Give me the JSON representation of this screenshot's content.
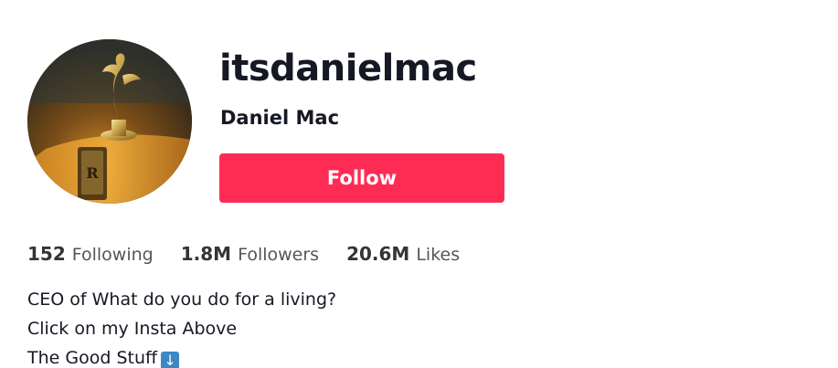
{
  "profile": {
    "username": "itsdanielmac",
    "display_name": "Daniel Mac",
    "follow_label": "Follow",
    "avatar_icon": "rolls-royce-hood-ornament"
  },
  "stats": [
    {
      "value": "152",
      "label": "Following"
    },
    {
      "value": "1.8M",
      "label": "Followers"
    },
    {
      "value": "20.6M",
      "label": "Likes"
    }
  ],
  "bio": {
    "lines": [
      "CEO of What do you do for a living?",
      "Click on my Insta Above",
      "The Good Stuff"
    ],
    "emoji": "↓"
  },
  "colors": {
    "follow_button": "#fe2c55",
    "text_primary": "#161823",
    "text_secondary": "#565656"
  }
}
